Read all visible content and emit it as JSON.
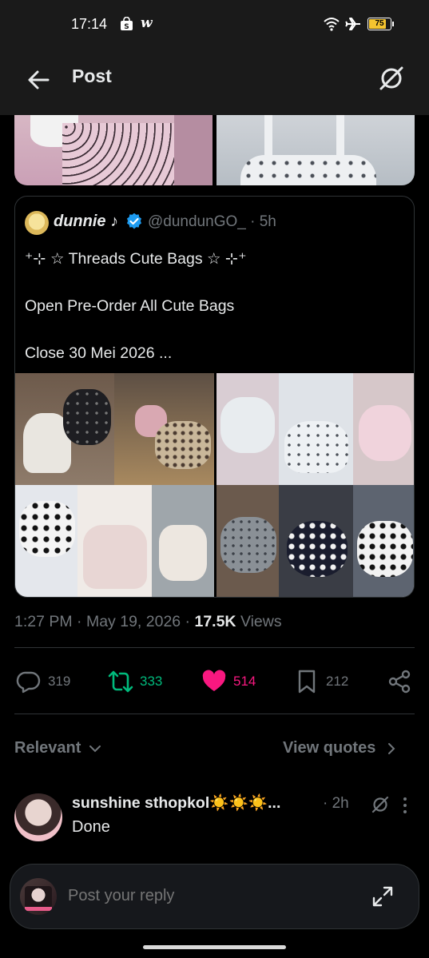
{
  "status_bar": {
    "time": "17:14",
    "battery": "75",
    "battery_level_percent": 75,
    "icons": [
      "shopping-bag-icon",
      "w-app-icon",
      "wifi-icon",
      "airplane-icon",
      "battery-icon"
    ]
  },
  "header": {
    "title": "Post",
    "back_icon": "arrow-left-icon",
    "grok_icon": "grok-icon"
  },
  "quote": {
    "name": "dunnie",
    "name_suffix": "♪",
    "handle": "@dundunGO_",
    "time": "· 5h",
    "text": "⁺⊹ ☆ Threads Cute Bags ☆ ⊹⁺\n\nOpen Pre-Order All Cute Bags\n\nClose 30 Mei 2026 ...",
    "verified_color": "#1d9bf0"
  },
  "meta": {
    "time": "1:27 PM",
    "sep1": " · ",
    "date": "May 19, 2026",
    "sep2": " · ",
    "views_count": "17.5K",
    "views_label": " Views"
  },
  "actions": {
    "replies": "319",
    "reposts": "333",
    "likes": "514",
    "bookmarks": "212",
    "repost_color": "#00ba7c",
    "like_color": "#f91880"
  },
  "sort": {
    "label": "Relevant",
    "view_quotes": "View quotes"
  },
  "reply": {
    "name": "sunshine sthopkol☀️☀️☀️...",
    "time": "· 2h",
    "text": "Done"
  },
  "composer": {
    "placeholder": "Post your reply"
  }
}
